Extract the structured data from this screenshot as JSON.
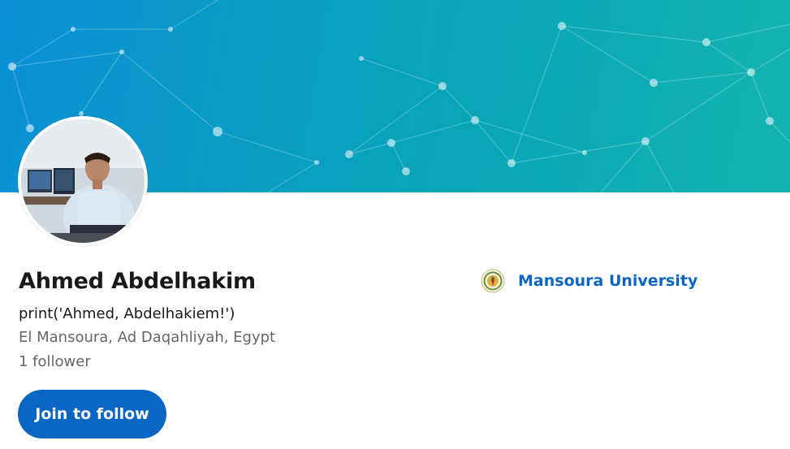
{
  "profile": {
    "name": "Ahmed Abdelhakim",
    "headline": "print('Ahmed, Abdelhakiem!')",
    "location": "El Mansoura, Ad Daqahliyah, Egypt",
    "followers": "1 follower",
    "follow_button": "Join to follow"
  },
  "education": {
    "school": "Mansoura University",
    "logo_icon": "university-seal-icon"
  },
  "colors": {
    "accent": "#0a66c2",
    "banner_start": "#0a8fd6",
    "banner_end": "#13b3b1"
  }
}
